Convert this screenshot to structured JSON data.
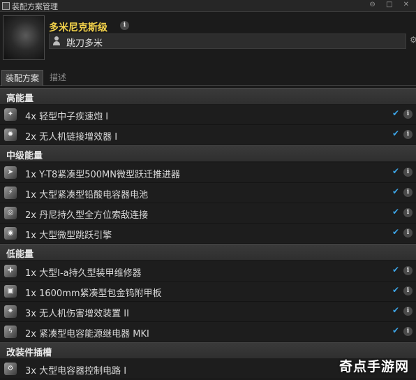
{
  "window": {
    "title": "装配方案管理",
    "controls": "⊖ □ ✕"
  },
  "ship": {
    "name": "多米尼克斯级",
    "pilot": "跳刀多米"
  },
  "tabs": [
    {
      "label": "装配方案"
    },
    {
      "label": "描述"
    }
  ],
  "sections": [
    {
      "title": "高能量",
      "modules": [
        {
          "qty": "4x",
          "name": "轻型中子疾速炮 I",
          "icon": "blaster-icon"
        },
        {
          "qty": "2x",
          "name": "无人机链接增效器 I",
          "icon": "drone-link-icon"
        }
      ]
    },
    {
      "title": "中级能量",
      "modules": [
        {
          "qty": "1x",
          "name": "Y-T8紧凑型500MN微型跃迁推进器",
          "icon": "microwarpdrive-icon"
        },
        {
          "qty": "1x",
          "name": "大型紧凑型铅酸电容器电池",
          "icon": "cap-battery-icon"
        },
        {
          "qty": "2x",
          "name": "丹尼持久型全方位索敌连接",
          "icon": "sensor-link-icon"
        },
        {
          "qty": "1x",
          "name": "大型微型跳跃引擎",
          "icon": "jump-drive-icon"
        }
      ]
    },
    {
      "title": "低能量",
      "modules": [
        {
          "qty": "1x",
          "name": "大型I-a持久型装甲维修器",
          "icon": "armor-repair-icon"
        },
        {
          "qty": "1x",
          "name": "1600mm紧凑型包金钨附甲板",
          "icon": "armor-plate-icon"
        },
        {
          "qty": "3x",
          "name": "无人机伤害增效装置 II",
          "icon": "drone-damage-icon"
        },
        {
          "qty": "2x",
          "name": "紧凑型电容能源继电器 MKI",
          "icon": "cap-relay-icon"
        }
      ]
    },
    {
      "title": "改装件插槽",
      "modules": [
        {
          "qty": "3x",
          "name": "大型电容器控制电路 I",
          "icon": "rig-icon"
        }
      ]
    }
  ],
  "watermark": "奇点手游网",
  "colors": {
    "accent": "#3da6e8",
    "ship_name": "#f2d14a"
  }
}
